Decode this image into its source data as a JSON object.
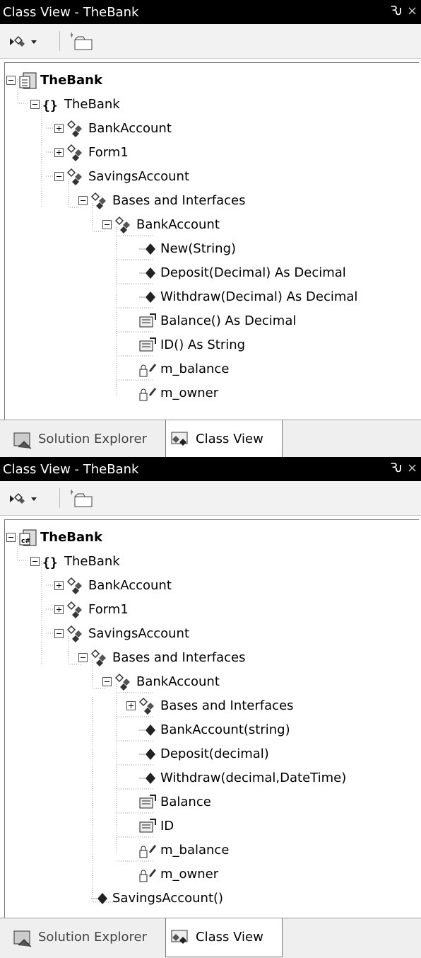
{
  "colors": {
    "titlebar": "#000000",
    "toolbar": "#f2f2f2",
    "tree_bg": "#ffffff",
    "tab_bar": "#efefef"
  },
  "panels": [
    {
      "title": "Class View - TheBank",
      "pin_glyph": "Ԅ",
      "close_glyph": "×",
      "toolbar": {
        "sort_icon": "sort-by-icon",
        "new_folder_icon": "new-folder-icon"
      },
      "tree": [
        {
          "label": "TheBank",
          "icon": "project-icon",
          "bold": true,
          "expander": "minus"
        },
        {
          "label": "TheBank",
          "icon": "namespace-icon",
          "bold": false,
          "expander": "minus"
        },
        {
          "label": "BankAccount",
          "icon": "class-icon",
          "bold": false,
          "expander": "plus"
        },
        {
          "label": "Form1",
          "icon": "class-icon",
          "bold": false,
          "expander": "plus"
        },
        {
          "label": "SavingsAccount",
          "icon": "class-icon",
          "bold": false,
          "expander": "minus"
        },
        {
          "label": "Bases and Interfaces",
          "icon": "class-icon",
          "bold": false,
          "expander": "minus"
        },
        {
          "label": "BankAccount",
          "icon": "class-icon",
          "bold": false,
          "expander": "minus"
        },
        {
          "label": "New(String)",
          "icon": "method-icon",
          "bold": false,
          "expander": ""
        },
        {
          "label": "Deposit(Decimal) As Decimal",
          "icon": "method-icon",
          "bold": false,
          "expander": ""
        },
        {
          "label": "Withdraw(Decimal) As Decimal",
          "icon": "method-icon",
          "bold": false,
          "expander": ""
        },
        {
          "label": "Balance() As Decimal",
          "icon": "property-icon",
          "bold": false,
          "expander": ""
        },
        {
          "label": "ID() As String",
          "icon": "property-icon",
          "bold": false,
          "expander": ""
        },
        {
          "label": "m_balance",
          "icon": "private-field-icon",
          "bold": false,
          "expander": ""
        },
        {
          "label": "m_owner",
          "icon": "private-field-icon",
          "bold": false,
          "expander": ""
        }
      ],
      "tabs": [
        {
          "label": "Solution Explorer",
          "icon": "solution-explorer-icon",
          "active": false
        },
        {
          "label": "Class View",
          "icon": "class-view-icon",
          "active": true
        }
      ]
    },
    {
      "title": "Class View - TheBank",
      "pin_glyph": "Ԅ",
      "close_glyph": "×",
      "toolbar": {
        "sort_icon": "sort-by-icon",
        "new_folder_icon": "new-folder-icon"
      },
      "tree": [
        {
          "label": "TheBank",
          "icon": "csharp-project-icon",
          "bold": true,
          "expander": "minus"
        },
        {
          "label": "TheBank",
          "icon": "namespace-icon",
          "bold": false,
          "expander": "minus"
        },
        {
          "label": "BankAccount",
          "icon": "class-icon",
          "bold": false,
          "expander": "plus"
        },
        {
          "label": "Form1",
          "icon": "class-icon",
          "bold": false,
          "expander": "plus"
        },
        {
          "label": "SavingsAccount",
          "icon": "class-icon",
          "bold": false,
          "expander": "minus"
        },
        {
          "label": "Bases and Interfaces",
          "icon": "class-icon",
          "bold": false,
          "expander": "minus"
        },
        {
          "label": "BankAccount",
          "icon": "class-icon",
          "bold": false,
          "expander": "minus"
        },
        {
          "label": "Bases and Interfaces",
          "icon": "class-icon",
          "bold": false,
          "expander": "plus"
        },
        {
          "label": "BankAccount(string)",
          "icon": "method-icon",
          "bold": false,
          "expander": ""
        },
        {
          "label": "Deposit(decimal)",
          "icon": "method-icon",
          "bold": false,
          "expander": ""
        },
        {
          "label": "Withdraw(decimal,DateTime)",
          "icon": "method-icon",
          "bold": false,
          "expander": ""
        },
        {
          "label": "Balance",
          "icon": "property-icon",
          "bold": false,
          "expander": ""
        },
        {
          "label": "ID",
          "icon": "property-icon",
          "bold": false,
          "expander": ""
        },
        {
          "label": "m_balance",
          "icon": "private-field-icon",
          "bold": false,
          "expander": ""
        },
        {
          "label": "m_owner",
          "icon": "private-field-icon",
          "bold": false,
          "expander": ""
        },
        {
          "label": "SavingsAccount()",
          "icon": "method-icon",
          "bold": false,
          "expander": ""
        }
      ],
      "tabs": [
        {
          "label": "Solution Explorer",
          "icon": "solution-explorer-icon",
          "active": false
        },
        {
          "label": "Class View",
          "icon": "class-view-icon",
          "active": true
        }
      ]
    }
  ]
}
